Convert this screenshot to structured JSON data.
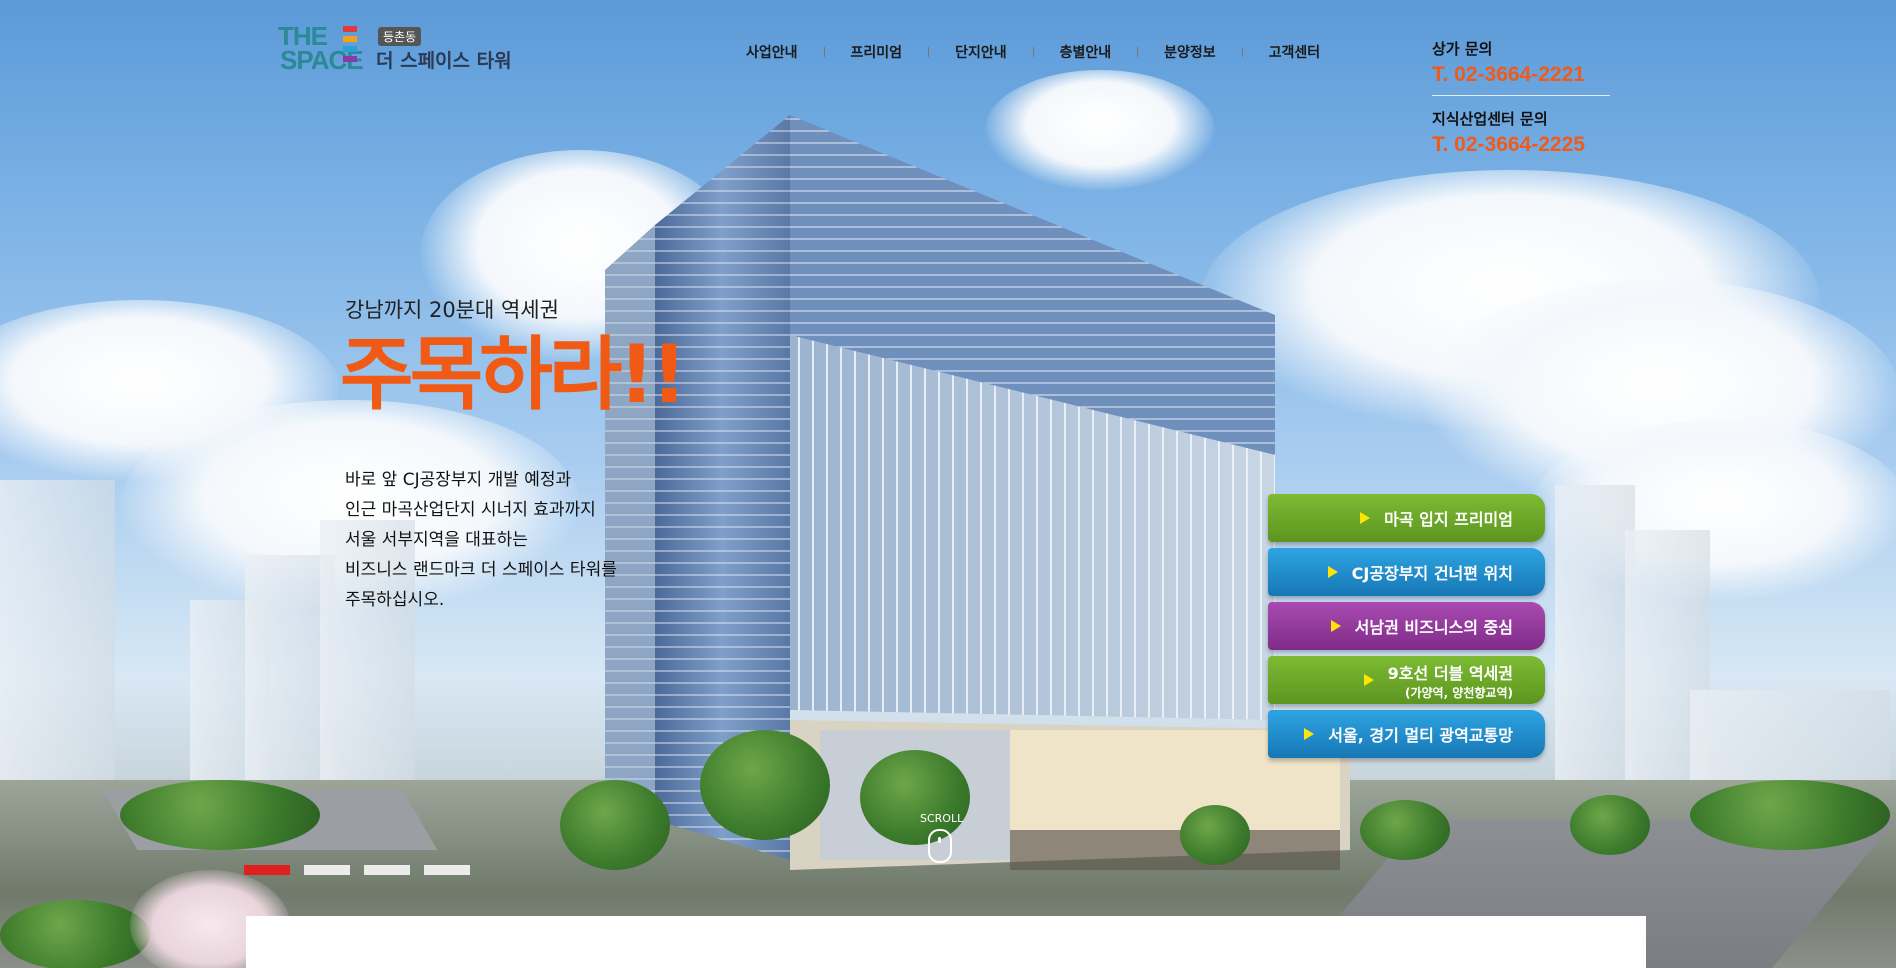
{
  "header": {
    "logo": {
      "line1": "THE",
      "line2": "SPACE",
      "badge": "등촌동",
      "name": "더 스페이스 타워",
      "colors": [
        "#e23a3a",
        "#f2a31b",
        "#29a0d8",
        "#8a3aa8"
      ]
    },
    "nav": [
      "사업안내",
      "프리미엄",
      "단지안내",
      "층별안내",
      "분양정보",
      "고객센터"
    ],
    "contacts": [
      {
        "label": "상가 문의",
        "phone": "T. 02-3664-2221"
      },
      {
        "label": "지식산업센터 문의",
        "phone": "T. 02-3664-2225"
      }
    ]
  },
  "hero": {
    "subtitle": "강남까지 20분대 역세권",
    "title": "주목하라!!",
    "body": [
      "바로 앞 CJ공장부지 개발 예정과",
      "인근 마곡산업단지 시너지 효과까지",
      "서울 서부지역을 대표하는",
      "비즈니스 랜드마크 더 스페이스 타워를",
      "주목하십시오."
    ]
  },
  "features": [
    {
      "label": "마곡 입지 프리미엄",
      "sub": "",
      "color": "#6ea82a"
    },
    {
      "label": "CJ공장부지 건너편 위치",
      "sub": "",
      "color": "#1f8fd0"
    },
    {
      "label": "서남권 비즈니스의 중심",
      "sub": "",
      "color": "#963a9e"
    },
    {
      "label": "9호선 더블 역세권",
      "sub": "(가양역, 양천향교역)",
      "color": "#6ea82a"
    },
    {
      "label": "서울, 경기 멀티 광역교통망",
      "sub": "",
      "color": "#1f8fd0"
    }
  ],
  "slider": {
    "count": 4,
    "active_index": 0
  },
  "scroll": {
    "label": "SCROLL"
  },
  "accent_color": "#f05a14"
}
